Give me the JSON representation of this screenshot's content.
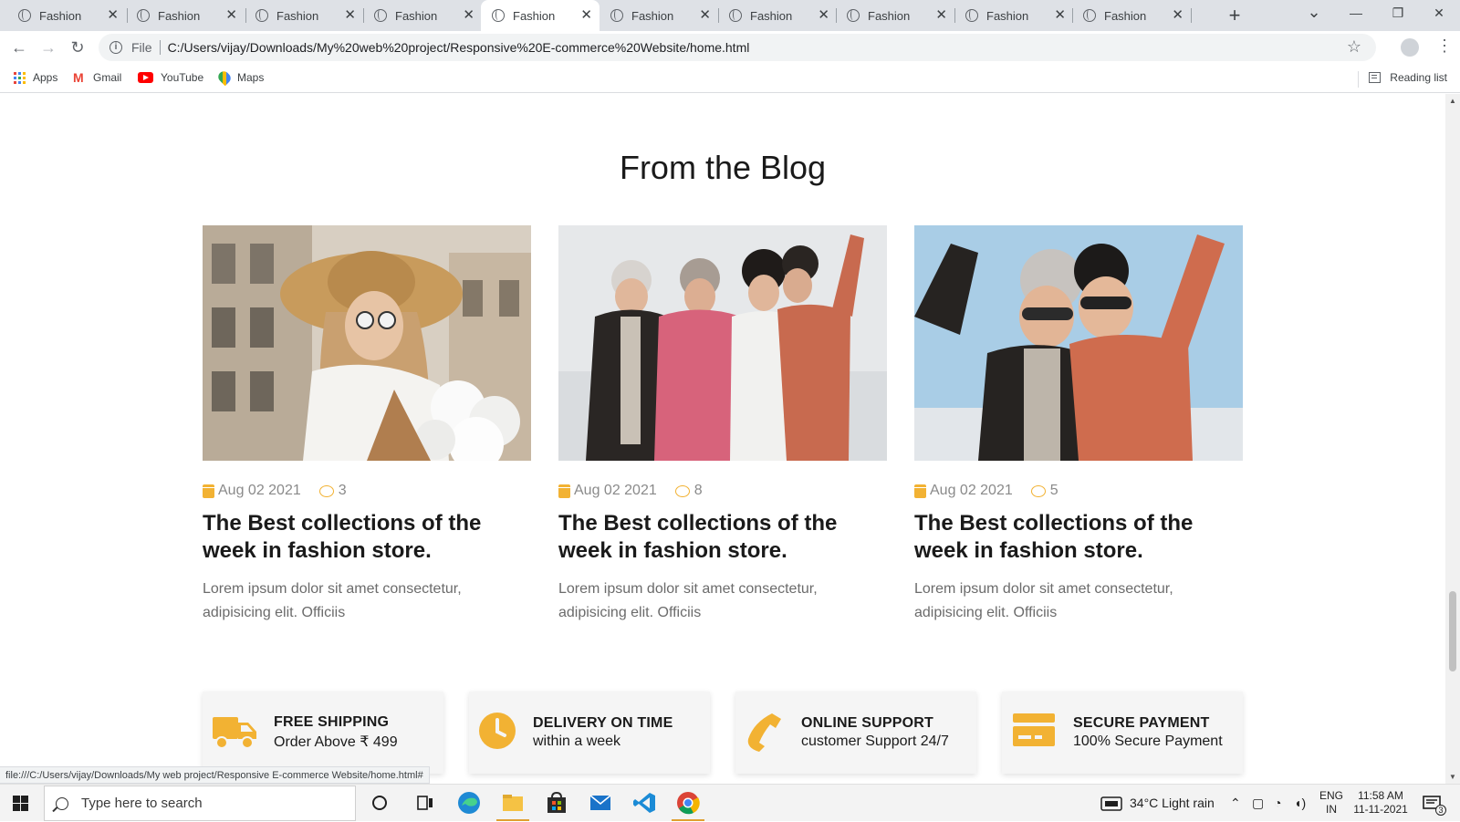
{
  "browser": {
    "tabs": [
      {
        "label": "Fashion",
        "active": false
      },
      {
        "label": "Fashion",
        "active": false
      },
      {
        "label": "Fashion",
        "active": false
      },
      {
        "label": "Fashion",
        "active": false
      },
      {
        "label": "Fashion",
        "active": true
      },
      {
        "label": "Fashion",
        "active": false
      },
      {
        "label": "Fashion",
        "active": false
      },
      {
        "label": "Fashion",
        "active": false
      },
      {
        "label": "Fashion",
        "active": false
      },
      {
        "label": "Fashion",
        "active": false
      }
    ],
    "tab_close_glyph": "✕",
    "new_tab_glyph": "+",
    "window_controls": {
      "tab_search": "⌄",
      "minimize": "—",
      "restore": "❐",
      "close": "✕"
    },
    "nav": {
      "back": "←",
      "forward": "→",
      "reload": "↻"
    },
    "address": {
      "info": "i",
      "scheme_label": "File",
      "url": "C:/Users/vijay/Downloads/My%20web%20project/Responsive%20E-commerce%20Website/home.html"
    },
    "star_glyph": "☆",
    "menu_glyph": "⋮",
    "bookmarks": [
      {
        "label": "Apps",
        "icon": "apps-grid-icon"
      },
      {
        "label": "Gmail",
        "icon": "gmail-icon"
      },
      {
        "label": "YouTube",
        "icon": "youtube-icon"
      },
      {
        "label": "Maps",
        "icon": "maps-icon"
      }
    ],
    "reading_list": "Reading list",
    "status_url": "file:///C:/Users/vijay/Downloads/My web project/Responsive E-commerce Website/home.html#"
  },
  "page": {
    "section_title": "From the Blog",
    "posts": [
      {
        "date": "Aug 02 2021",
        "comments": "3",
        "title": "The Best collections of the week in fashion store.",
        "excerpt": "Lorem ipsum dolor sit amet consectetur, adipisicing elit. Officiis"
      },
      {
        "date": "Aug 02 2021",
        "comments": "8",
        "title": "The Best collections of the week in fashion store.",
        "excerpt": "Lorem ipsum dolor sit amet consectetur, adipisicing elit. Officiis"
      },
      {
        "date": "Aug 02 2021",
        "comments": "5",
        "title": "The Best collections of the week in fashion store.",
        "excerpt": "Lorem ipsum dolor sit amet consectetur, adipisicing elit. Officiis"
      }
    ],
    "features": [
      {
        "title": "FREE SHIPPING",
        "subtitle": "Order Above ₹ 499",
        "icon": "truck-icon"
      },
      {
        "title": "DELIVERY ON TIME",
        "subtitle": "within a week",
        "icon": "clock-icon"
      },
      {
        "title": "ONLINE SUPPORT",
        "subtitle": "customer Support 24/7",
        "icon": "phone-icon"
      },
      {
        "title": "SECURE PAYMENT",
        "subtitle": "100% Secure Payment",
        "icon": "credit-card-icon"
      }
    ],
    "accent_color": "#f2b233"
  },
  "taskbar": {
    "search_placeholder": "Type here to search",
    "weather": "34°C  Light rain",
    "language": {
      "line1": "ENG",
      "line2": "IN"
    },
    "time": "11:58 AM",
    "date": "11-11-2021",
    "notifications": "3"
  }
}
